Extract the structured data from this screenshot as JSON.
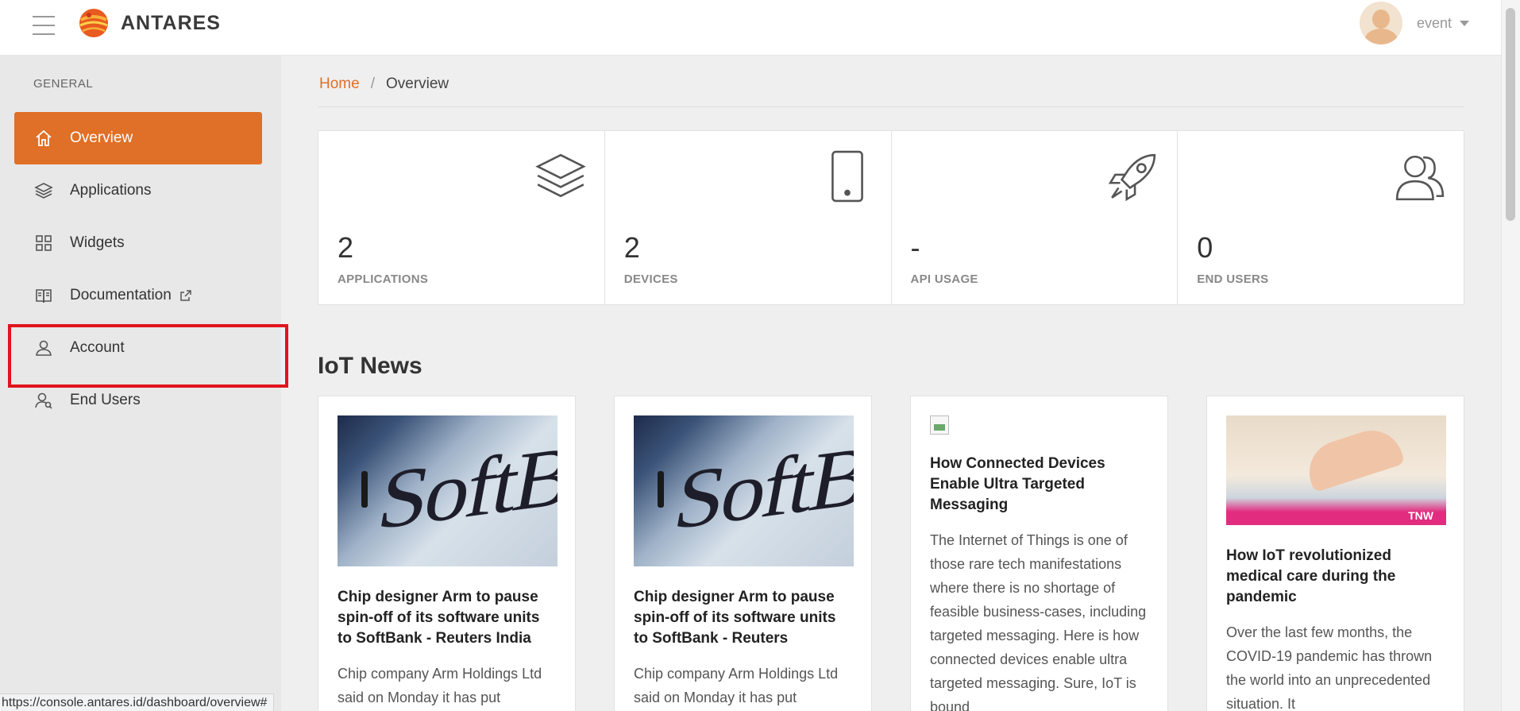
{
  "app": {
    "brand_name": "ANTARES",
    "accent_color": "#e07027"
  },
  "user": {
    "name": "event"
  },
  "sidebar": {
    "heading": "GENERAL",
    "items": [
      {
        "label": "Overview",
        "icon": "home-icon",
        "active": true
      },
      {
        "label": "Applications",
        "icon": "layers-icon"
      },
      {
        "label": "Widgets",
        "icon": "grid-icon"
      },
      {
        "label": "Documentation",
        "icon": "book-icon",
        "external": true
      },
      {
        "label": "Account",
        "icon": "user-icon",
        "highlighted": true
      },
      {
        "label": "End Users",
        "icon": "user-search-icon"
      }
    ]
  },
  "breadcrumb": {
    "home": "Home",
    "separator": "/",
    "current": "Overview"
  },
  "stats": [
    {
      "value": "2",
      "label": "APPLICATIONS",
      "icon": "layers-icon"
    },
    {
      "value": "2",
      "label": "DEVICES",
      "icon": "tablet-icon"
    },
    {
      "value": "-",
      "label": "API USAGE",
      "icon": "rocket-icon"
    },
    {
      "value": "0",
      "label": "END USERS",
      "icon": "users-icon"
    }
  ],
  "news": {
    "title": "IoT News",
    "articles": [
      {
        "headline": "Chip designer Arm to pause spin-off of its software units to SoftBank - Reuters India",
        "excerpt": "Chip company Arm Holdings Ltd said on Monday it has put",
        "image": "softbank-stage-photo"
      },
      {
        "headline": "Chip designer Arm to pause spin-off of its software units to SoftBank - Reuters",
        "excerpt": "Chip company Arm Holdings Ltd said on Monday it has put",
        "image": "softbank-stage-photo"
      },
      {
        "headline": "How Connected Devices Enable Ultra Targeted Messaging",
        "excerpt": "The Internet of Things is one of those rare tech manifestations where there is no shortage of feasible business-cases, including targeted messaging. Here is how connected devices enable ultra targeted messaging. Sure, IoT is bound",
        "image": "broken-image"
      },
      {
        "headline": "How IoT revolutionized medical care during the pandemic",
        "excerpt": "Over the last few months, the COVID-19 pandemic has thrown the world into an unprecedented situation. It",
        "image": "laptop-hands-photo",
        "image_badge": "TNW"
      }
    ]
  },
  "status_bar": {
    "url": "https://console.antares.id/dashboard/overview#"
  }
}
